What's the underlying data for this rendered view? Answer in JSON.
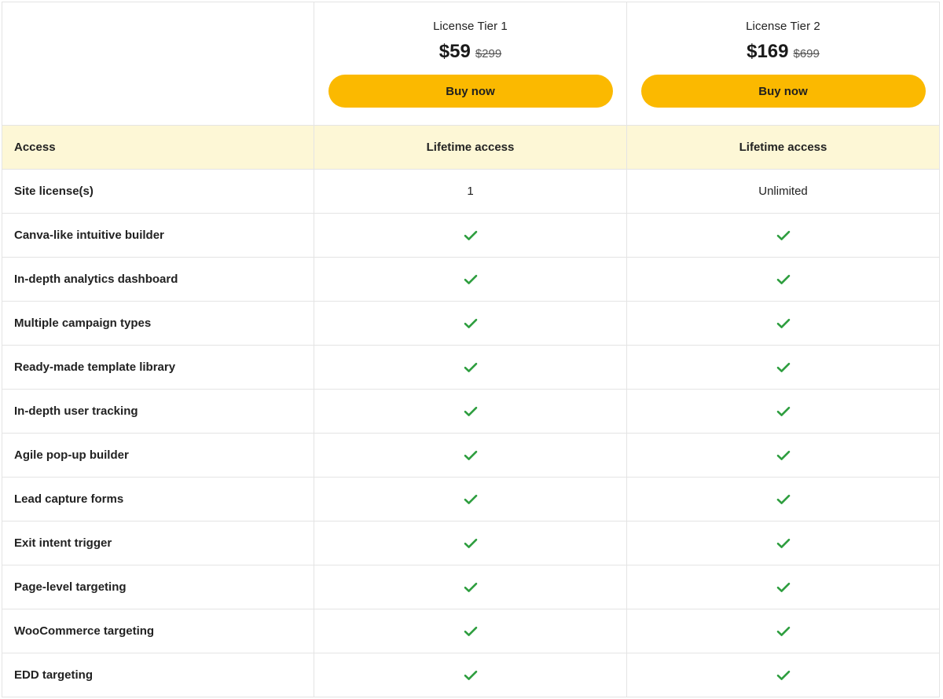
{
  "tiers": [
    {
      "name": "License Tier 1",
      "price": "$59",
      "old_price": "$299",
      "button_label": "Buy now"
    },
    {
      "name": "License Tier 2",
      "price": "$169",
      "old_price": "$699",
      "button_label": "Buy now"
    }
  ],
  "access": {
    "label": "Access",
    "values": [
      "Lifetime access",
      "Lifetime access"
    ]
  },
  "site_licenses": {
    "label": "Site license(s)",
    "values": [
      "1",
      "Unlimited"
    ]
  },
  "features": [
    "Canva-like intuitive builder",
    "In-depth analytics dashboard",
    "Multiple campaign types",
    "Ready-made template library",
    "In-depth user tracking",
    "Agile pop-up builder",
    "Lead capture forms",
    "Exit intent trigger",
    "Page-level targeting",
    "WooCommerce targeting",
    "EDD targeting"
  ],
  "icons": {
    "included": "check-icon"
  },
  "colors": {
    "accent_button": "#fbb900",
    "check_green": "#2e9e3f",
    "access_row_bg": "#fdf7d6"
  }
}
